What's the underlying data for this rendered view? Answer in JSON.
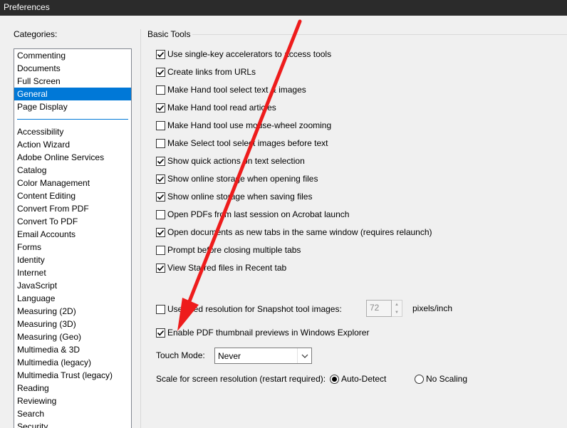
{
  "window": {
    "title": "Preferences"
  },
  "categories": {
    "label": "Categories:",
    "top_items": [
      {
        "label": "Commenting",
        "selected": false
      },
      {
        "label": "Documents",
        "selected": false
      },
      {
        "label": "Full Screen",
        "selected": false
      },
      {
        "label": "General",
        "selected": true
      },
      {
        "label": "Page Display",
        "selected": false
      }
    ],
    "items": [
      "Accessibility",
      "Action Wizard",
      "Adobe Online Services",
      "Catalog",
      "Color Management",
      "Content Editing",
      "Convert From PDF",
      "Convert To PDF",
      "Email Accounts",
      "Forms",
      "Identity",
      "Internet",
      "JavaScript",
      "Language",
      "Measuring (2D)",
      "Measuring (3D)",
      "Measuring (Geo)",
      "Multimedia & 3D",
      "Multimedia (legacy)",
      "Multimedia Trust (legacy)",
      "Reading",
      "Reviewing",
      "Search",
      "Security"
    ]
  },
  "basic_tools": {
    "label": "Basic Tools",
    "options": [
      {
        "label": "Use single-key accelerators to access tools",
        "checked": true
      },
      {
        "label": "Create links from URLs",
        "checked": true
      },
      {
        "label": "Make Hand tool select text & images",
        "checked": false
      },
      {
        "label": "Make Hand tool read articles",
        "checked": true
      },
      {
        "label": "Make Hand tool use mouse-wheel zooming",
        "checked": false
      },
      {
        "label": "Make Select tool select images before text",
        "checked": false
      },
      {
        "label": "Show quick actions on text selection",
        "checked": true
      },
      {
        "label": "Show online storage when opening files",
        "checked": true
      },
      {
        "label": "Show online storage when saving files",
        "checked": true
      },
      {
        "label": "Open PDFs from last session on Acrobat launch",
        "checked": false
      },
      {
        "label": "Open documents as new tabs in the same window (requires relaunch)",
        "checked": true
      },
      {
        "label": "Prompt before closing multiple tabs",
        "checked": false
      },
      {
        "label": "View Starred files in Recent tab",
        "checked": true
      }
    ]
  },
  "snapshot": {
    "label": "Use fixed resolution for Snapshot tool images:",
    "checked": false,
    "value": "72",
    "units": "pixels/inch"
  },
  "thumbnail": {
    "label": "Enable PDF thumbnail previews in Windows Explorer",
    "checked": true
  },
  "touch_mode": {
    "label": "Touch Mode:",
    "value": "Never"
  },
  "scale": {
    "label": "Scale for screen resolution (restart required):",
    "options": [
      {
        "label": "Auto-Detect",
        "selected": true
      },
      {
        "label": "No Scaling",
        "selected": false
      }
    ]
  },
  "colors": {
    "selection": "#0078d7",
    "annotation_arrow": "#ee1c1c",
    "titlebar": "#2b2b2b"
  },
  "icons": {
    "checkmark": "checkmark-icon",
    "spinner": "spin-arrows",
    "dropdown": "chevron-down-icon"
  }
}
